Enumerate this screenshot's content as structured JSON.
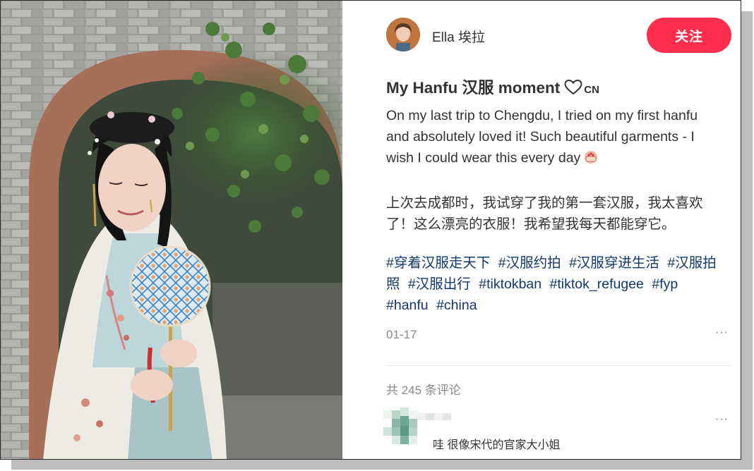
{
  "post": {
    "author_name": "Ella 埃拉",
    "follow_label": "关注",
    "title": "My Hanfu 汉服 moment",
    "title_flag": "CN",
    "body_en": "On my last trip to Chengdu, I tried on my first hanfu and absolutely loved it! Such beautiful garments - I wish I could wear this every day",
    "body_zh": "上次去成都时，我试穿了我的第一套汉服，我太喜欢了！这么漂亮的衣服！我希望我每天都能穿它。",
    "hashtags": [
      "#穿着汉服走天下",
      "#汉服约拍",
      "#汉服穿进生活",
      "#汉服拍照",
      "#汉服出行",
      "#tiktokban",
      "#tiktok_refugee",
      "#fyp",
      "#hanfu",
      "#china"
    ],
    "date": "01-17",
    "more_label": "···"
  },
  "comments": {
    "count_label": "共 245 条评论",
    "items": [
      {
        "text": "哇 很像宋代的官家大小姐",
        "more_label": "···"
      }
    ]
  },
  "colors": {
    "accent": "#ff2e4d",
    "hashtag": "#13386c",
    "text": "#333333",
    "muted": "#8a8a8a"
  },
  "icons": [
    "heart-outline-icon",
    "cake-emoji-icon",
    "more-dots-icon"
  ]
}
